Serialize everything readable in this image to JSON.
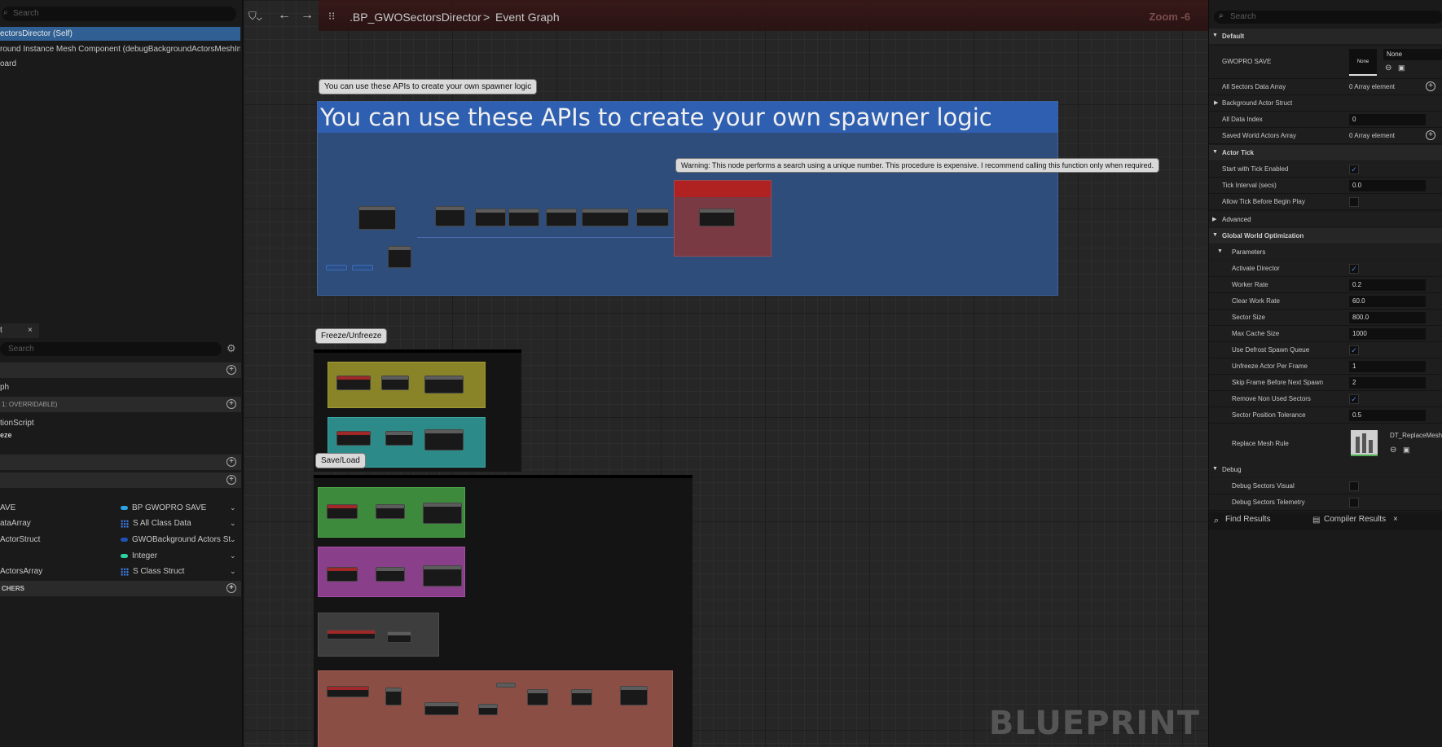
{
  "left": {
    "search_placeholder": "Search",
    "components": [
      {
        "label": "ectorsDirector (Self)",
        "selected": true
      },
      {
        "label": "round Instance Mesh Component (debugBackgroundActorsMeshInst",
        "selected": false
      },
      {
        "label": "oard",
        "selected": false
      }
    ],
    "mybp_tab": "t",
    "mybp_close": "×",
    "mybp_search": "Search",
    "graph_item": "ph",
    "overridable": "1: OVERRIDABLE)",
    "function_items": [
      "tionScript",
      "eze"
    ],
    "variables": [
      {
        "name": "AVE",
        "type": "BP GWOPRO SAVE",
        "icon": "pill",
        "color": "#2aa3e0"
      },
      {
        "name": "ataArray",
        "type": "S All Class Data",
        "icon": "grid",
        "color": "#3b74d6"
      },
      {
        "name": "ActorStruct",
        "type": "GWOBackground Actors St",
        "icon": "pill",
        "color": "#1f52b5"
      },
      {
        "name": "",
        "type": "Integer",
        "icon": "pill",
        "color": "#2ed1a0"
      },
      {
        "name": "ActorsArray",
        "type": "S Class Struct",
        "icon": "grid",
        "color": "#3b74d6"
      }
    ],
    "dispatchers": "CHERS"
  },
  "graph": {
    "breadcrumb_bp": ".BP_GWOSectorsDirector",
    "breadcrumb_sep": ">",
    "breadcrumb_graph": "Event Graph",
    "zoom": "Zoom -6",
    "comment1_tag": "You can use these APIs to create your own spawner logic",
    "comment1_title": "You can use these APIs to create your own spawner logic",
    "warning_tag": "Warning: This node performs a search using a unique number. This procedure is expensive. I recommend calling this function only when required.",
    "comment2_tag": "Freeze/Unfreeze",
    "comment3_tag": "Save/Load",
    "watermark": "BLUEPRINT",
    "colors": {
      "blue_comment": "#2f4d7a",
      "blue_header": "#2f5fb0",
      "yellow": "#8a8428",
      "teal": "#2c8b88",
      "green": "#3d8a3c",
      "magenta": "#8a3f8a",
      "grey_box": "#4a4a4a",
      "salmon": "#8a4e45",
      "warning_red": "#7a2828"
    }
  },
  "details": {
    "search_placeholder": "Search",
    "categories": {
      "default": "Default",
      "actor_tick": "Actor Tick",
      "advanced": "Advanced",
      "gwo": "Global World Optimization",
      "parameters": "Parameters",
      "debug": "Debug"
    },
    "default_rows": {
      "gwopro_save": {
        "label": "GWOPRO SAVE",
        "thumb": "None",
        "value": "None"
      },
      "all_sectors": {
        "label": "All Sectors Data Array",
        "value": "0 Array element"
      },
      "bg_actor": {
        "label": "Background Actor Struct"
      },
      "all_data_index": {
        "label": "All Data Index",
        "value": "0"
      },
      "saved_world": {
        "label": "Saved World Actors Array",
        "value": "0 Array element"
      }
    },
    "tick_rows": {
      "start_tick": {
        "label": "Start with Tick Enabled",
        "checked": true
      },
      "tick_interval": {
        "label": "Tick Interval (secs)",
        "value": "0.0"
      },
      "allow_tick": {
        "label": "Allow Tick Before Begin Play",
        "checked": false
      }
    },
    "params": {
      "activate": {
        "label": "Activate Director",
        "checked": true
      },
      "worker_rate": {
        "label": "Worker Rate",
        "value": "0.2"
      },
      "clear_work_rate": {
        "label": "Clear Work Rate",
        "value": "60.0"
      },
      "sector_size": {
        "label": "Sector Size",
        "value": "800.0"
      },
      "max_cache": {
        "label": "Max Cache Size",
        "value": "1000"
      },
      "defrost": {
        "label": "Use Defrost Spawn Queue",
        "checked": true
      },
      "unfreeze": {
        "label": "Unfreeze Actor Per Frame",
        "value": "1"
      },
      "skip_frame": {
        "label": "Skip Frame Before Next Spawn",
        "value": "2"
      },
      "remove_unused": {
        "label": "Remove Non Used Sectors",
        "checked": true
      },
      "tolerance": {
        "label": "Sector Position Tolerance",
        "value": "0.5"
      },
      "replace_mesh": {
        "label": "Replace Mesh Rule",
        "value": "DT_ReplaceMesh"
      }
    },
    "debug": {
      "visual": {
        "label": "Debug Sectors Visual",
        "checked": false
      },
      "telemetry": {
        "label": "Debug Sectors Telemetry",
        "checked": false
      }
    },
    "bottom_tabs": {
      "find": "Find Results",
      "compiler": "Compiler Results",
      "close": "×"
    }
  }
}
